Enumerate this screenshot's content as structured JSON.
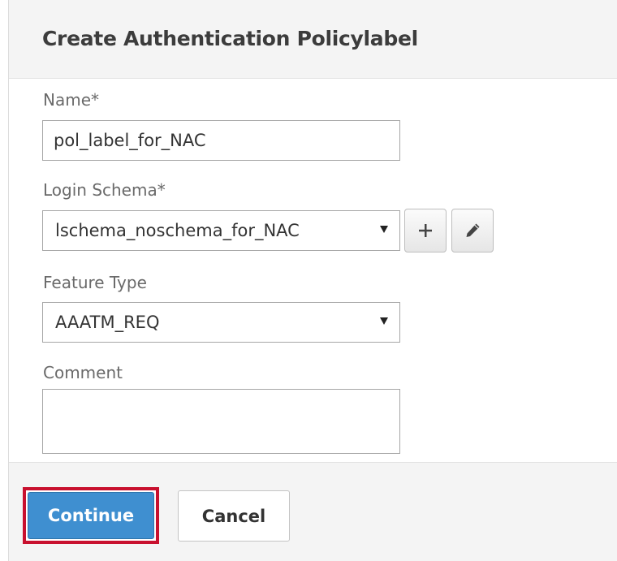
{
  "dialog": {
    "title": "Create Authentication Policylabel"
  },
  "form": {
    "name": {
      "label": "Name*",
      "value": "pol_label_for_NAC"
    },
    "login_schema": {
      "label": "Login Schema*",
      "value": "lschema_noschema_for_NAC",
      "add_icon": "plus-icon",
      "edit_icon": "pencil-icon"
    },
    "feature_type": {
      "label": "Feature Type",
      "value": "AAATM_REQ"
    },
    "comment": {
      "label": "Comment",
      "value": ""
    }
  },
  "footer": {
    "continue_label": "Continue",
    "cancel_label": "Cancel"
  },
  "colors": {
    "primary_button": "#3f8fd0",
    "highlight_border": "#c8102e",
    "panel_background": "#f4f4f4"
  }
}
